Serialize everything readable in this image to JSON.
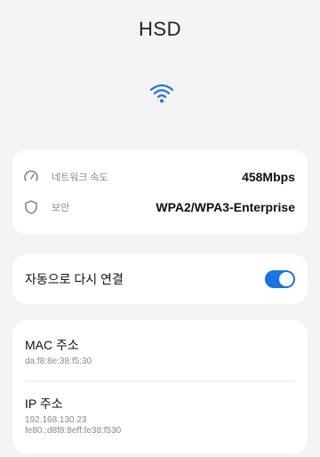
{
  "header": {
    "title": "HSD",
    "wifi_icon": "wifi-signal-icon",
    "accent": "#1a73e8"
  },
  "details": {
    "speed": {
      "label": "네트워크 속도",
      "value": "458Mbps",
      "icon": "speedometer-icon"
    },
    "security": {
      "label": "보안",
      "value": "WPA2/WPA3-Enterprise",
      "icon": "shield-icon"
    }
  },
  "reconnect": {
    "label": "자동으로 다시 연결",
    "enabled": true
  },
  "addresses": {
    "mac": {
      "label": "MAC 주소",
      "value": "da:f8:8e:38:f5:30"
    },
    "ip": {
      "label": "IP 주소",
      "ipv4": "192.168.130.23",
      "ipv6": "fe80::d8f8:8eff:fe38:f530"
    }
  }
}
